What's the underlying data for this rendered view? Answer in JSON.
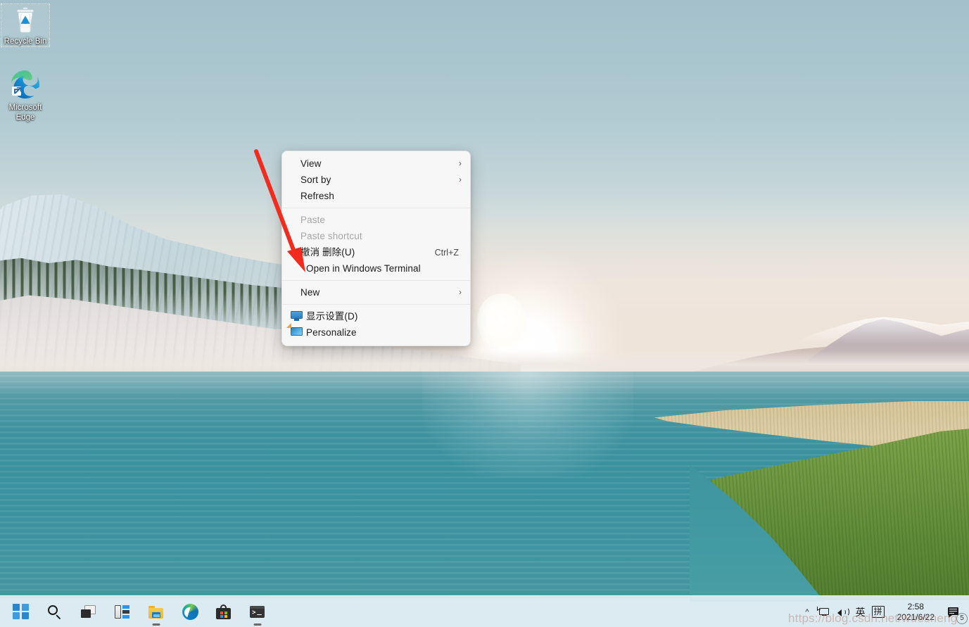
{
  "desktop": {
    "wallpaper_name": "windows-11-glacier-lake",
    "icons": [
      {
        "id": "recycle-bin",
        "label": "Recycle Bin",
        "icon": "recycle-bin-icon",
        "selected": true
      },
      {
        "id": "microsoft-edge",
        "label": "Microsoft Edge",
        "icon": "edge-icon",
        "selected": false
      }
    ]
  },
  "context_menu": {
    "groups": [
      {
        "items": [
          {
            "id": "view",
            "label": "View",
            "icon": null,
            "accel": "",
            "submenu": true,
            "disabled": false
          },
          {
            "id": "sort-by",
            "label": "Sort by",
            "icon": null,
            "accel": "",
            "submenu": true,
            "disabled": false
          },
          {
            "id": "refresh",
            "label": "Refresh",
            "icon": null,
            "accel": "",
            "submenu": false,
            "disabled": false
          }
        ]
      },
      {
        "items": [
          {
            "id": "paste",
            "label": "Paste",
            "icon": null,
            "accel": "",
            "submenu": false,
            "disabled": true
          },
          {
            "id": "paste-shortcut",
            "label": "Paste shortcut",
            "icon": null,
            "accel": "",
            "submenu": false,
            "disabled": true
          },
          {
            "id": "undo-delete",
            "label": "撤消 删除(U)",
            "icon": null,
            "accel": "Ctrl+Z",
            "submenu": false,
            "disabled": false
          },
          {
            "id": "open-terminal",
            "label": "Open in Windows Terminal",
            "icon": "terminal-icon",
            "accel": "",
            "submenu": false,
            "disabled": false
          }
        ]
      },
      {
        "items": [
          {
            "id": "new",
            "label": "New",
            "icon": null,
            "accel": "",
            "submenu": true,
            "disabled": false
          }
        ]
      },
      {
        "items": [
          {
            "id": "display-settings",
            "label": "显示设置(D)",
            "icon": "display-icon",
            "accel": "",
            "submenu": false,
            "disabled": false
          },
          {
            "id": "personalize",
            "label": "Personalize",
            "icon": "personalize-icon",
            "accel": "",
            "submenu": false,
            "disabled": false
          }
        ]
      }
    ]
  },
  "annotation": {
    "arrow_color": "#f32b1e",
    "arrow_target": "open-terminal"
  },
  "taskbar": {
    "buttons": [
      {
        "id": "start",
        "label": "Start",
        "icon": "windows-start-icon",
        "running": false
      },
      {
        "id": "search",
        "label": "Search",
        "icon": "search-icon",
        "running": false
      },
      {
        "id": "task-view",
        "label": "Task view",
        "icon": "task-view-icon",
        "running": false
      },
      {
        "id": "widgets",
        "label": "Widgets",
        "icon": "widgets-icon",
        "running": false
      },
      {
        "id": "explorer",
        "label": "File Explorer",
        "icon": "folder-icon",
        "running": true
      },
      {
        "id": "edge",
        "label": "Microsoft Edge",
        "icon": "edge-icon",
        "running": false
      },
      {
        "id": "store",
        "label": "Microsoft Store",
        "icon": "store-icon",
        "running": false
      },
      {
        "id": "terminal",
        "label": "Windows Terminal",
        "icon": "terminal-icon",
        "running": true
      }
    ]
  },
  "tray": {
    "show_hidden_label": "^",
    "items": [
      {
        "id": "network",
        "label": "Network",
        "icon": "network-icon"
      },
      {
        "id": "volume",
        "label": "Volume",
        "icon": "volume-icon"
      },
      {
        "id": "ime-mode",
        "label": "英",
        "icon": "ime-language-icon"
      },
      {
        "id": "ime-pin",
        "label": "拼",
        "icon": "ime-pinyin-icon"
      }
    ],
    "clock": {
      "time": "2:58",
      "date": "2021/6/22"
    },
    "notifications": {
      "icon": "notification-icon",
      "count": "5"
    }
  },
  "watermark": {
    "text": "https://blog.csdn.net/wuesheng",
    "color": "#be8c82"
  }
}
